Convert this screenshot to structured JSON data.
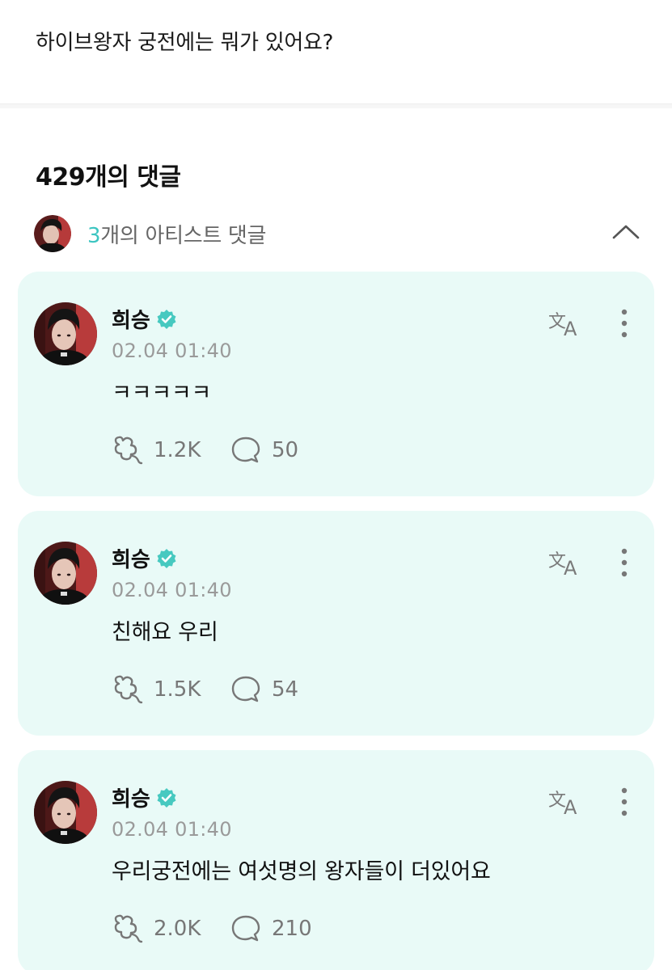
{
  "post": {
    "title": "하이브왕자 궁전에는 뭐가 있어요?"
  },
  "comments_header": {
    "count_label": "429개의 댓글"
  },
  "artist_section": {
    "count": "3",
    "label_suffix": "개의 아티스트 댓글",
    "expanded": true
  },
  "colors": {
    "card_bg": "#e9faf7",
    "accent": "#3cc5c1",
    "verified": "#47c9c0"
  },
  "comments": [
    {
      "author": "희승",
      "verified": true,
      "time": "02.04 01:40",
      "text": "ㅋㅋㅋㅋㅋ",
      "likes": "1.2K",
      "replies": "50"
    },
    {
      "author": "희승",
      "verified": true,
      "time": "02.04 01:40",
      "text": "친해요 우리",
      "likes": "1.5K",
      "replies": "54"
    },
    {
      "author": "희승",
      "verified": true,
      "time": "02.04 01:40",
      "text": "우리궁전에는 여섯명의 왕자들이 더있어요",
      "likes": "2.0K",
      "replies": "210"
    }
  ],
  "icons": {
    "translate": "translate-icon",
    "more": "more-vertical-icon",
    "like": "heart-paw-icon",
    "reply": "speech-bubble-icon",
    "chevron": "chevron-up-icon"
  }
}
